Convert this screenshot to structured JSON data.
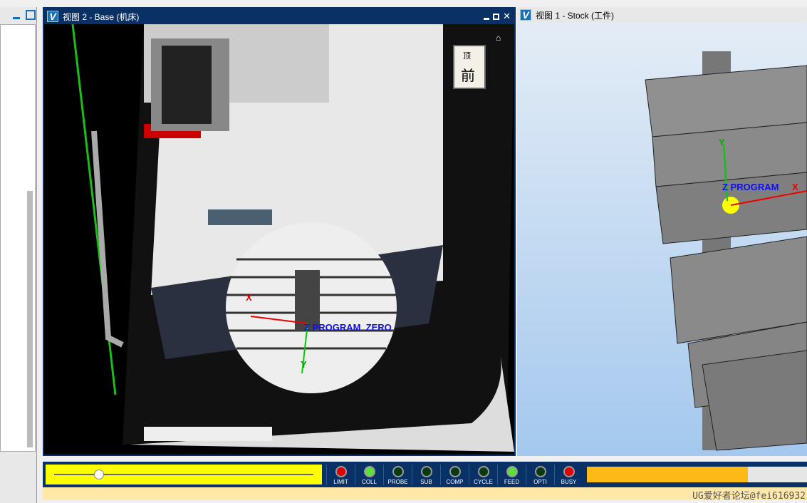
{
  "view2": {
    "title": "视图 2 - Base (机床)",
    "orient_top": "顶",
    "orient_front": "前",
    "axis_x": "X",
    "axis_y": "Y",
    "zero_label": "Z PROGRAM_ZERO"
  },
  "view1": {
    "title": "视图 1 - Stock (工件)",
    "axis_y": "Y",
    "zero_label": "Z PROGRAM",
    "axis_x": "X"
  },
  "status": {
    "slider_value": 0.16,
    "progress_percent": 73,
    "progress_color": "#fdb915",
    "leds": [
      {
        "label": "LIMIT",
        "color": "#e00000"
      },
      {
        "label": "COLL",
        "color": "#5ee03a"
      },
      {
        "label": "PROBE",
        "color": "#0a3a10"
      },
      {
        "label": "SUB",
        "color": "#0a3a10"
      },
      {
        "label": "COMP",
        "color": "#0a3a10"
      },
      {
        "label": "CYCLE",
        "color": "#0a3a10"
      },
      {
        "label": "FEED",
        "color": "#5ee03a"
      },
      {
        "label": "OPTI",
        "color": "#0a3a10"
      },
      {
        "label": "BUSY",
        "color": "#e00000"
      }
    ],
    "watermark": "UG爱好者论坛@fei616932"
  }
}
